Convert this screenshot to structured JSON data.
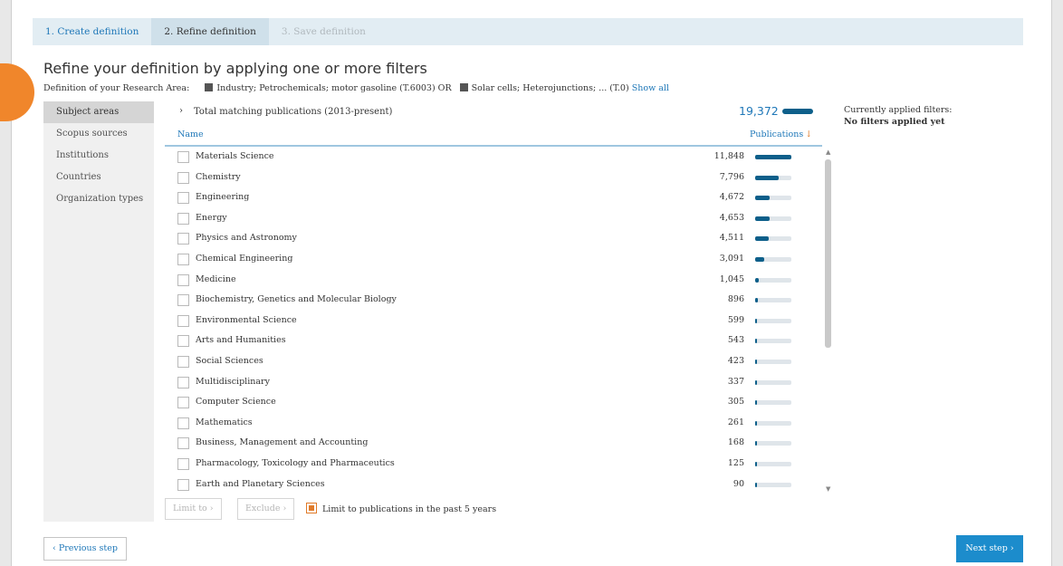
{
  "wizard": {
    "steps": [
      {
        "label": "1. Create definition",
        "state": "done"
      },
      {
        "label": "2. Refine definition",
        "state": "active"
      },
      {
        "label": "3. Save definition",
        "state": "todo"
      }
    ]
  },
  "page_title": "Refine your definition by applying one or more filters",
  "definition": {
    "label": "Definition of your Research Area:",
    "topic1": "Industry; Petrochemicals; motor gasoline (T.6003) OR",
    "topic2": "Solar cells; Heterojunctions; ... (T.0)",
    "show_all": "Show all"
  },
  "sidebar": {
    "items": [
      {
        "label": "Subject areas",
        "selected": true
      },
      {
        "label": "Scopus sources",
        "selected": false
      },
      {
        "label": "Institutions",
        "selected": false
      },
      {
        "label": "Countries",
        "selected": false
      },
      {
        "label": "Organization types",
        "selected": false
      }
    ]
  },
  "total": {
    "label": "Total matching publications (2013-present)",
    "value": "19,372"
  },
  "columns": {
    "name": "Name",
    "publications": "Publications"
  },
  "rows": [
    {
      "name": "Materials Science",
      "value": "11,848",
      "count": 11848
    },
    {
      "name": "Chemistry",
      "value": "7,796",
      "count": 7796
    },
    {
      "name": "Engineering",
      "value": "4,672",
      "count": 4672
    },
    {
      "name": "Energy",
      "value": "4,653",
      "count": 4653
    },
    {
      "name": "Physics and Astronomy",
      "value": "4,511",
      "count": 4511
    },
    {
      "name": "Chemical Engineering",
      "value": "3,091",
      "count": 3091
    },
    {
      "name": "Medicine",
      "value": "1,045",
      "count": 1045
    },
    {
      "name": "Biochemistry, Genetics and Molecular Biology",
      "value": "896",
      "count": 896
    },
    {
      "name": "Environmental Science",
      "value": "599",
      "count": 599
    },
    {
      "name": "Arts and Humanities",
      "value": "543",
      "count": 543
    },
    {
      "name": "Social Sciences",
      "value": "423",
      "count": 423
    },
    {
      "name": "Multidisciplinary",
      "value": "337",
      "count": 337
    },
    {
      "name": "Computer Science",
      "value": "305",
      "count": 305
    },
    {
      "name": "Mathematics",
      "value": "261",
      "count": 261
    },
    {
      "name": "Business, Management and Accounting",
      "value": "168",
      "count": 168
    },
    {
      "name": "Pharmacology, Toxicology and Pharmaceutics",
      "value": "125",
      "count": 125
    },
    {
      "name": "Earth and Planetary Sciences",
      "value": "90",
      "count": 90
    }
  ],
  "actions": {
    "limit_to": "Limit to",
    "exclude": "Exclude",
    "limit_5_years": "Limit to publications in the past 5 years",
    "limit_5_years_checked": true
  },
  "filters_panel": {
    "heading": "Currently applied filters:",
    "value": "No filters applied yet"
  },
  "nav": {
    "previous": "Previous step",
    "next": "Next step"
  },
  "colors": {
    "accent": "#1c8ccc",
    "bar": "#0d5f8a",
    "orange": "#f0862b"
  }
}
